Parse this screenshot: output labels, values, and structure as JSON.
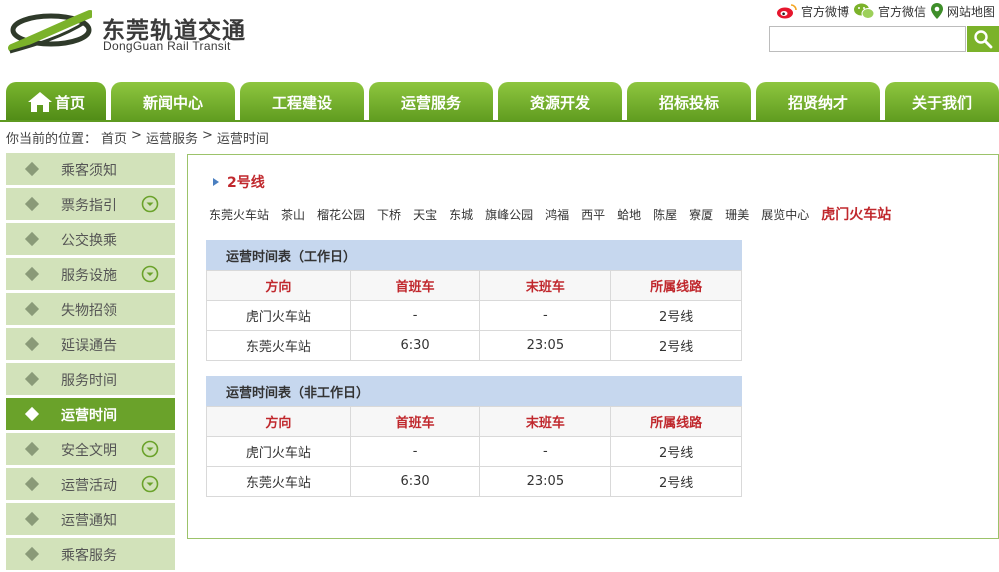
{
  "header": {
    "logo_cn": "东莞轨道交通",
    "logo_en": "DongGuan Rail Transit",
    "links": [
      "官方微博",
      "官方微信",
      "网站地图"
    ],
    "search_placeholder": ""
  },
  "nav": [
    "首页",
    "新闻中心",
    "工程建设",
    "运营服务",
    "资源开发",
    "招标投标",
    "招贤纳才",
    "关于我们"
  ],
  "breadcrumb": [
    "你当前的位置：",
    "首页",
    ">",
    "运营服务",
    ">",
    "运营时间"
  ],
  "sidebar": [
    {
      "label": "乘客须知",
      "expandable": false,
      "active": false
    },
    {
      "label": "票务指引",
      "expandable": true,
      "active": false
    },
    {
      "label": "公交换乘",
      "expandable": false,
      "active": false
    },
    {
      "label": "服务设施",
      "expandable": true,
      "active": false
    },
    {
      "label": "失物招领",
      "expandable": false,
      "active": false
    },
    {
      "label": "延误通告",
      "expandable": false,
      "active": false
    },
    {
      "label": "服务时间",
      "expandable": false,
      "active": false
    },
    {
      "label": "运营时间",
      "expandable": false,
      "active": true
    },
    {
      "label": "安全文明",
      "expandable": true,
      "active": false
    },
    {
      "label": "运营活动",
      "expandable": true,
      "active": false
    },
    {
      "label": "运营通知",
      "expandable": false,
      "active": false
    },
    {
      "label": "乘客服务",
      "expandable": false,
      "active": false
    }
  ],
  "main": {
    "line_title": "2号线",
    "stations": [
      "东莞火车站",
      "茶山",
      "榴花公园",
      "下桥",
      "天宝",
      "东城",
      "旗峰公园",
      "鸿福",
      "西平",
      "蛤地",
      "陈屋",
      "寮厦",
      "珊美",
      "展览中心",
      "虎门火车站"
    ],
    "current_station": "虎门火车站",
    "tables": [
      {
        "title": "运营时间表（工作日）",
        "headers": [
          "方向",
          "首班车",
          "末班车",
          "所属线路"
        ],
        "rows": [
          [
            "虎门火车站",
            "-",
            "-",
            "2号线"
          ],
          [
            "东莞火车站",
            "6:30",
            "23:05",
            "2号线"
          ]
        ]
      },
      {
        "title": "运营时间表（非工作日）",
        "headers": [
          "方向",
          "首班车",
          "末班车",
          "所属线路"
        ],
        "rows": [
          [
            "虎门火车站",
            "-",
            "-",
            "2号线"
          ],
          [
            "东莞火车站",
            "6:30",
            "23:05",
            "2号线"
          ]
        ]
      }
    ]
  },
  "colors": {
    "nav_green": "#6aa22a",
    "sidebar_bg": "#d2e2ba",
    "accent_red": "#c0282d",
    "table_header_blue": "#c6d7ee"
  }
}
